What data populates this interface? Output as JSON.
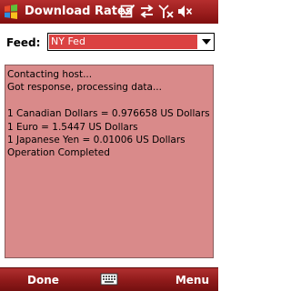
{
  "title_bar": {
    "title": "Download Rates",
    "icons": [
      "windows-start-icon",
      "tasks-check-icon",
      "connectivity-arrows-icon",
      "no-signal-icon",
      "volume-muted-icon"
    ]
  },
  "feed": {
    "label": "Feed:",
    "selected": "NY Fed"
  },
  "output": {
    "lines": [
      "Contacting host...",
      "Got response, processing data...",
      "",
      "1 Canadian Dollars = 0.976658 US Dollars",
      "1 Euro = 1.5447 US Dollars",
      "1 Japanese Yen = 0.01006 US Dollars",
      "Operation Completed"
    ]
  },
  "softkeys": {
    "left": "Done",
    "right": "Menu"
  },
  "colors": {
    "title_bar": "#9a1d1d",
    "selection": "#db4242",
    "output_background": "#d98a8a"
  }
}
